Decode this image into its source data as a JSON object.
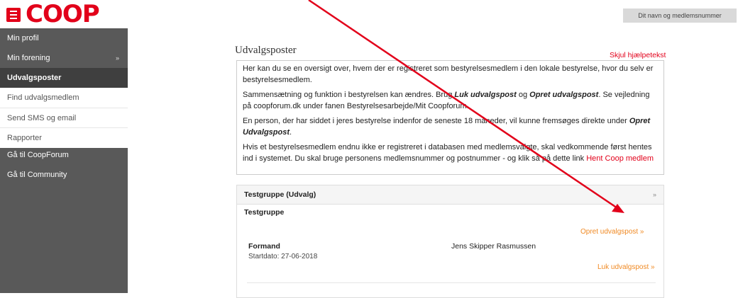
{
  "header": {
    "logo": "COOP",
    "user_placeholder": "Dit navn og medlemsnummer"
  },
  "sidebar": {
    "items": [
      {
        "label": "Min profil"
      },
      {
        "label": "Min forening"
      },
      {
        "label": "Udvalgsposter"
      },
      {
        "label": "Find udvalgsmedlem"
      },
      {
        "label": "Send SMS og email"
      },
      {
        "label": "Rapporter"
      },
      {
        "label": "Gå til CoopForum"
      },
      {
        "label": "Gå til Community"
      }
    ]
  },
  "main": {
    "title": "Udvalgsposter",
    "help_toggle": "Skjul hjælpetekst",
    "help": {
      "p1": "Her kan du se en oversigt over, hvem der er registreret som bestyrelsesmedlem i den lokale bestyrelse, hvor du selv er bestyrelsesmedlem.",
      "p2_a": "Sammensætning og funktion i bestyrelsen kan ændres. Brug ",
      "p2_b": "Luk udvalgspost",
      "p2_c": " og ",
      "p2_d": "Opret udvalgspost",
      "p2_e": ". Se vejledning på coopforum.dk under fanen Bestyrelsesarbejde/Mit Coopforum.",
      "p3_a": "En person, der har siddet i jeres bestyrelse indenfor de seneste 18 måneder, vil kunne fremsøges direkte under ",
      "p3_b": "Opret Udvalgspost",
      "p3_c": ".",
      "p4_a": "Hvis et bestyrelsesmedlem endnu ikke er registreret i databasen med medlemsvalgte, skal vedkommende først hentes ind i systemet. Du skal bruge personens medlemsnummer og postnummer - og klik så på dette link ",
      "p4_link": "Hent Coop medlem"
    },
    "panel": {
      "title": "Testgruppe (Udvalg)",
      "group_name": "Testgruppe",
      "create_link": "Opret udvalgspost »",
      "role": "Formand",
      "start_date": "Startdato: 27-06-2018",
      "person": "Jens Skipper Rasmussen",
      "close_link": "Luk udvalgspost »"
    }
  },
  "colors": {
    "brand_red": "#e2001a",
    "sidebar": "#595959",
    "sidebar_active": "#3f3f3f",
    "link_orange": "#f08a24"
  }
}
